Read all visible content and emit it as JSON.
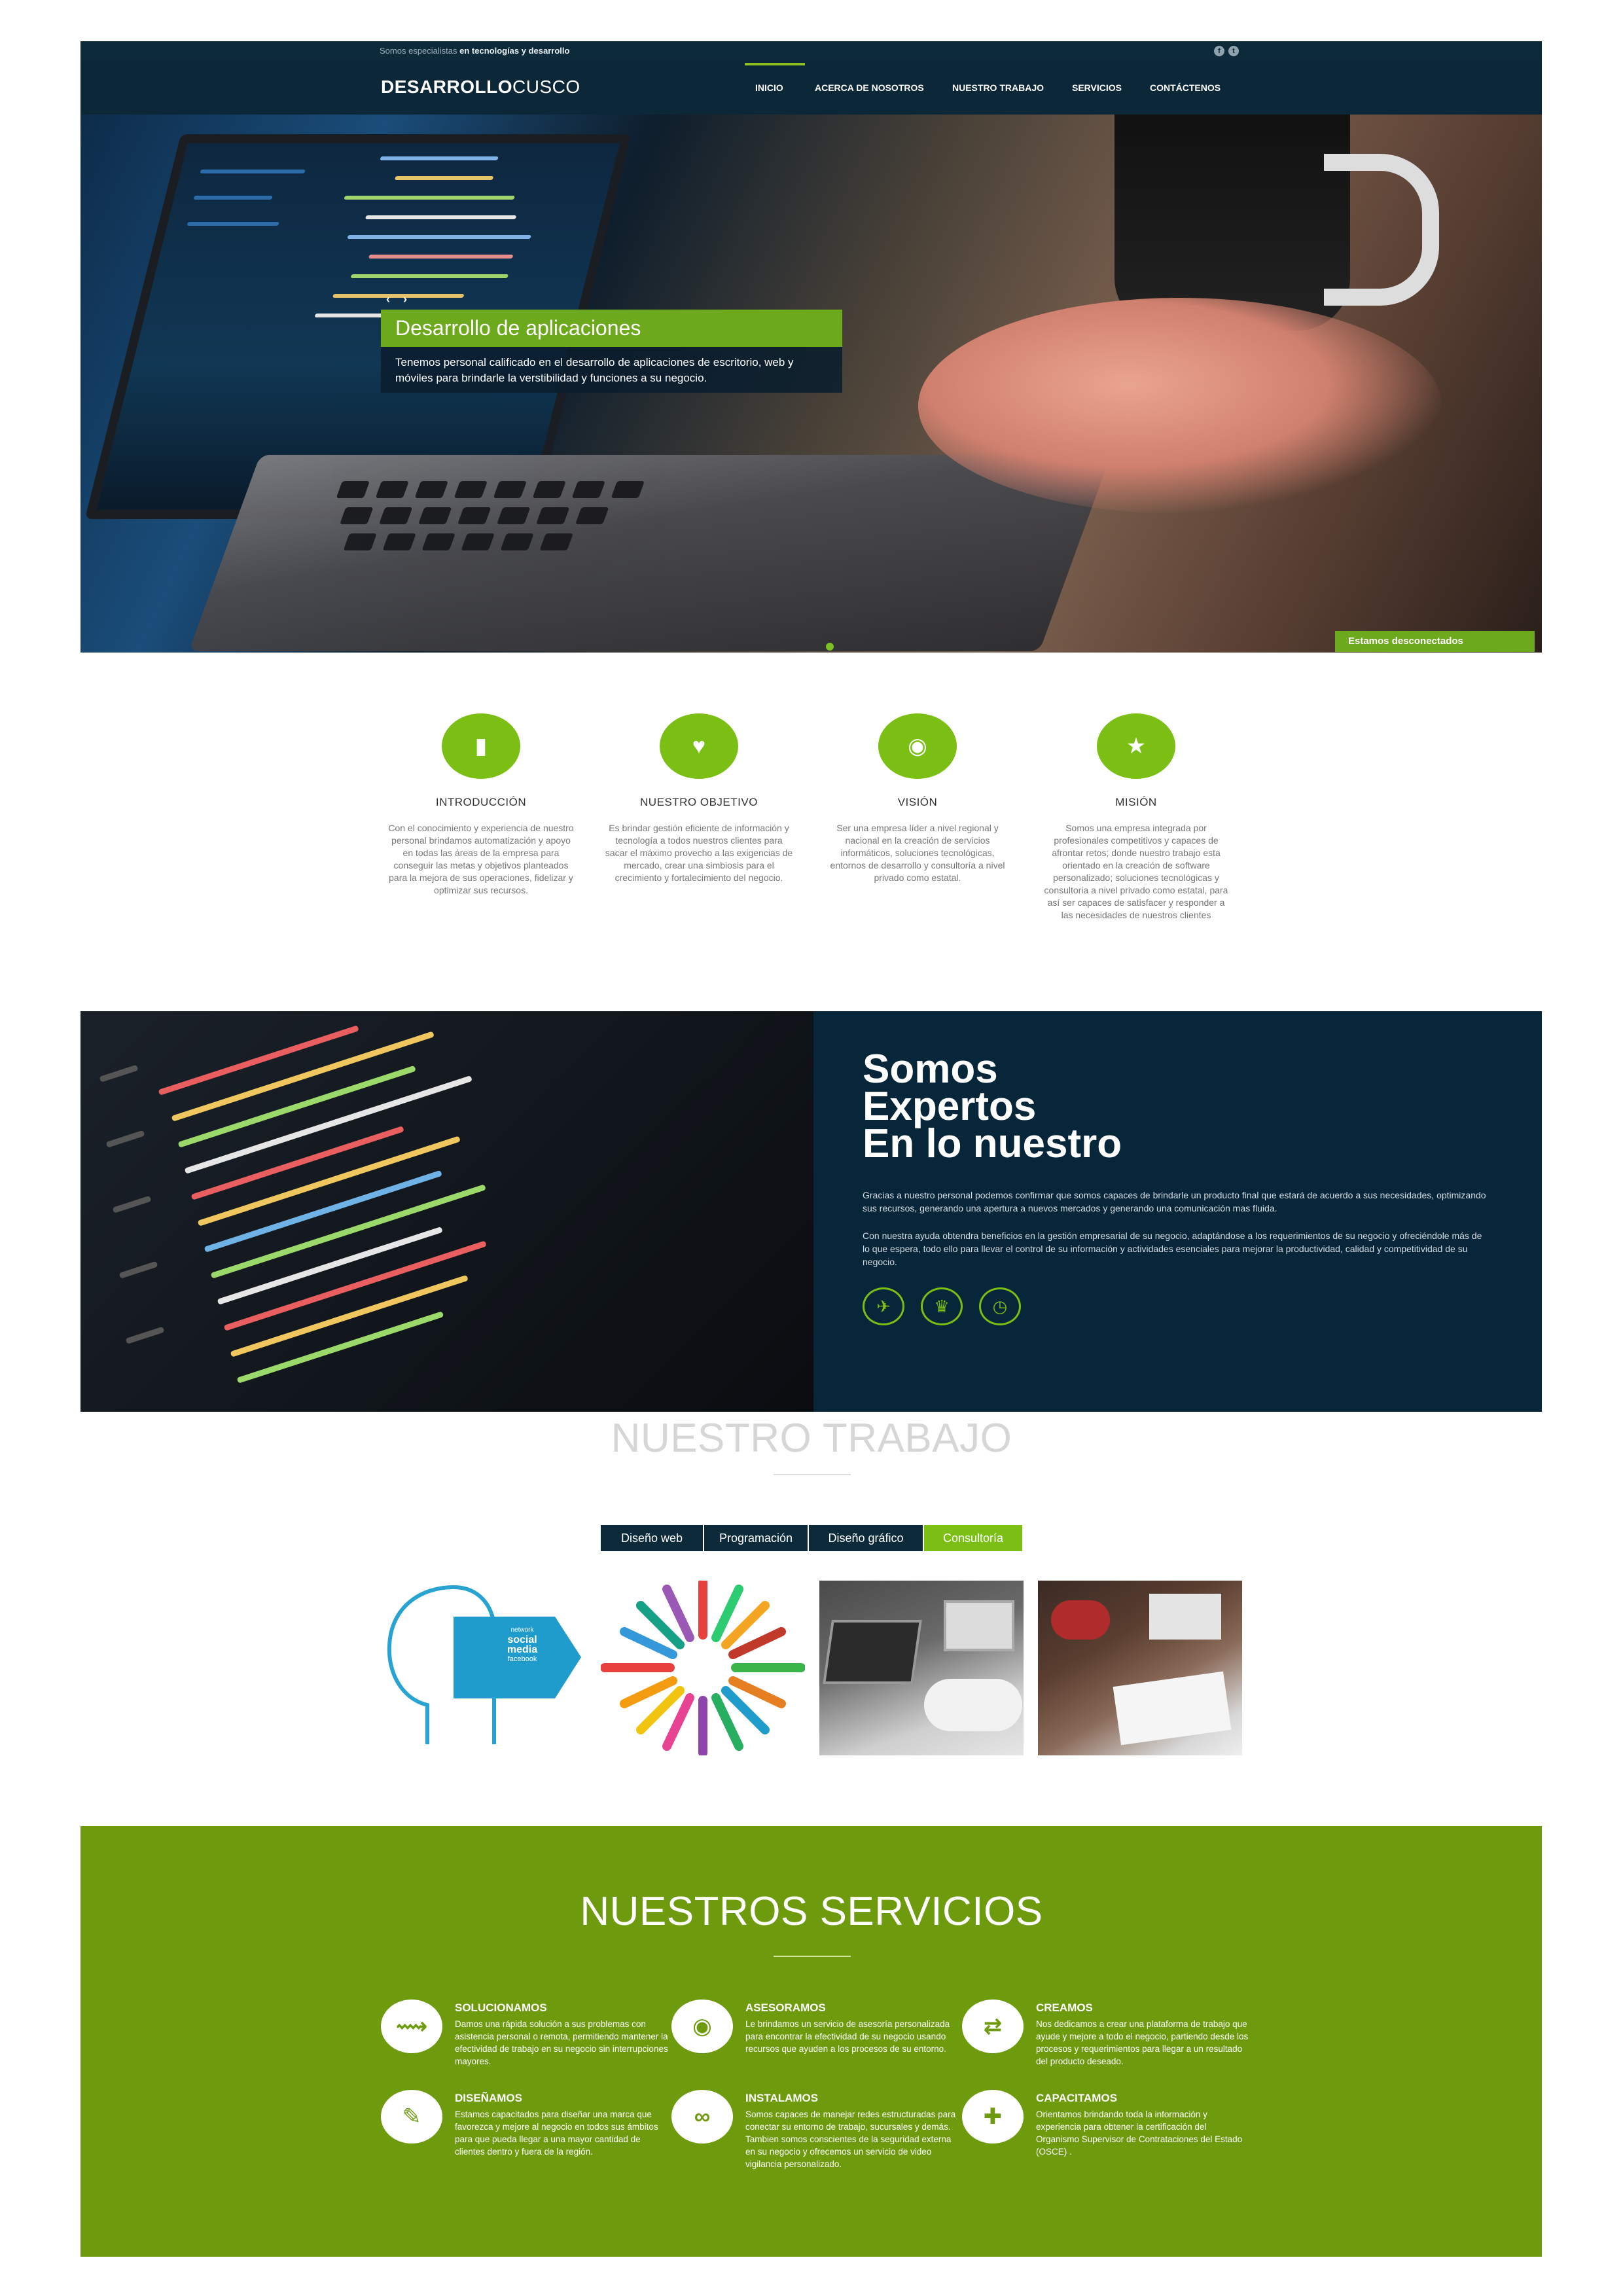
{
  "header": {
    "tagline_plain": "Somos especialistas ",
    "tagline_bold": "en tecnologías y desarrollo",
    "social": [
      "f",
      "t"
    ],
    "logo_bold": "DESARROLLO",
    "logo_light": "CUSCO",
    "nav": [
      "INICIO",
      "ACERCA DE NOSOTROS",
      "NUESTRO TRABAJO",
      "SERVICIOS",
      "CONTÁCTENOS"
    ]
  },
  "hero": {
    "arrow_prev": "‹",
    "arrow_next": "›",
    "title": "Desarrollo de aplicaciones",
    "description": "Tenemos personal calificado en el desarrollo de aplicaciones de escritorio, web y móviles para brindarle la verstibilidad y funciones a su negocio.",
    "chat_status": "Estamos desconectados"
  },
  "features": [
    {
      "icon": "book-icon",
      "glyph": "▮",
      "title": "INTRODUCCIÓN",
      "text": "Con el conocimiento y experiencia de nuestro personal brindamos automatización y apoyo en todas las áreas de la empresa para conseguir las metas y objetivos planteados para la mejora de sus operaciones, fidelizar y optimizar sus recursos."
    },
    {
      "icon": "heart-icon",
      "glyph": "♥",
      "title": "NUESTRO OBJETIVO",
      "text": "Es brindar gestión eficiente de información y tecnología a todos nuestros clientes para sacar el máximo provecho a las exigencias de mercado, crear una simbiosis para el crecimiento y fortalecimiento del negocio."
    },
    {
      "icon": "eye-icon",
      "glyph": "◉",
      "title": "VISIÓN",
      "text": "Ser una empresa líder a nivel regional y nacional en la creación de servicios informáticos, soluciones tecnológicas, entornos de desarrollo y consultoría a nivel privado como estatal."
    },
    {
      "icon": "star-icon",
      "glyph": "★",
      "title": "MISIÓN",
      "text": "Somos una empresa integrada por profesionales competitivos y capaces de afrontar retos; donde nuestro trabajo esta orientado en la creación de software personalizado; soluciones tecnológicas y consultoria a nivel privado como estatal, para así ser capaces de satisfacer y responder a las necesidades de nuestros clientes"
    }
  ],
  "experts": {
    "title_lines": [
      "Somos",
      "Expertos",
      "En lo nuestro"
    ],
    "p1": "Gracias a nuestro personal podemos confirmar que somos capaces de brindarle un producto final que estará de acuerdo a sus necesidades, optimizando sus recursos, generando una apertura a nuevos mercados y generando una comunicación mas fluida.",
    "p2": "Con nuestra ayuda obtendra beneficios en la gestión empresarial de su negocio, adaptándose a los requerimientos de su negocio y ofreciéndole más de lo que espera, todo ello para llevar el control de su información y actividades esenciales para mejorar la productividad, calidad y competitividad de su negocio.",
    "icons": [
      {
        "name": "paper-plane-icon",
        "glyph": "✈"
      },
      {
        "name": "trophy-icon",
        "glyph": "♛"
      },
      {
        "name": "clock-icon",
        "glyph": "◷"
      }
    ]
  },
  "work": {
    "title": "NUESTRO TRABAJO",
    "tabs": [
      "Diseño web",
      "Programación",
      "Diseño gráfico",
      "Consultoría"
    ],
    "active_tab": "Consultoría",
    "social_media_words": [
      "social",
      "media",
      "network",
      "facebook"
    ]
  },
  "services": {
    "title": "NUESTROS SERVICIOS",
    "items": [
      {
        "icon": "link-icon",
        "glyph": "⟿",
        "title": "SOLUCIONAMOS",
        "text": "Damos una rápida solución a sus problemas con asistencia personal o remota, permitiendo mantener la efectividad de trabajo en su negocio sin interrupciones mayores."
      },
      {
        "icon": "eye-icon",
        "glyph": "◉",
        "title": "ASESORAMOS",
        "text": "Le brindamos un servicio de asesoría personalizada para encontrar la efectividad de su negocio usando recursos que ayuden a los procesos de su entorno."
      },
      {
        "icon": "shuffle-icon",
        "glyph": "⇄",
        "title": "CREAMOS",
        "text": "Nos dedicamos a crear una plataforma de trabajo que ayude y mejore a todo el negocio, partiendo desde los procesos y requerimientos para llegar a un resultado del producto deseado."
      },
      {
        "icon": "brush-icon",
        "glyph": "✎",
        "title": "DISEÑAMOS",
        "text": "Estamos capacitados para diseñar una marca que favorezca y mejore al negocio en todos sus ámbitos para que pueda llegar a una mayor cantidad de clientes dentro y fuera de la región."
      },
      {
        "icon": "chain-icon",
        "glyph": "∞",
        "title": "INSTALAMOS",
        "text": "Somos capaces de manejar redes estructuradas para conectar su entorno de trabajo, sucursales y demás. Tambien somos conscientes de la seguridad externa en su negocio y ofrecemos un servicio de video vigilancia personalizado."
      },
      {
        "icon": "add-user-icon",
        "glyph": "✚",
        "title": "CAPACITAMOS",
        "text": "Orientamos brindando toda la información y experiencia para obtener la certificación del Organismo Supervisor de Contrataciones del Estado (OSCE) ."
      }
    ]
  },
  "colors": {
    "navy": "#0b2738",
    "green": "#7bbf14",
    "services_green": "#6e9a0e"
  }
}
